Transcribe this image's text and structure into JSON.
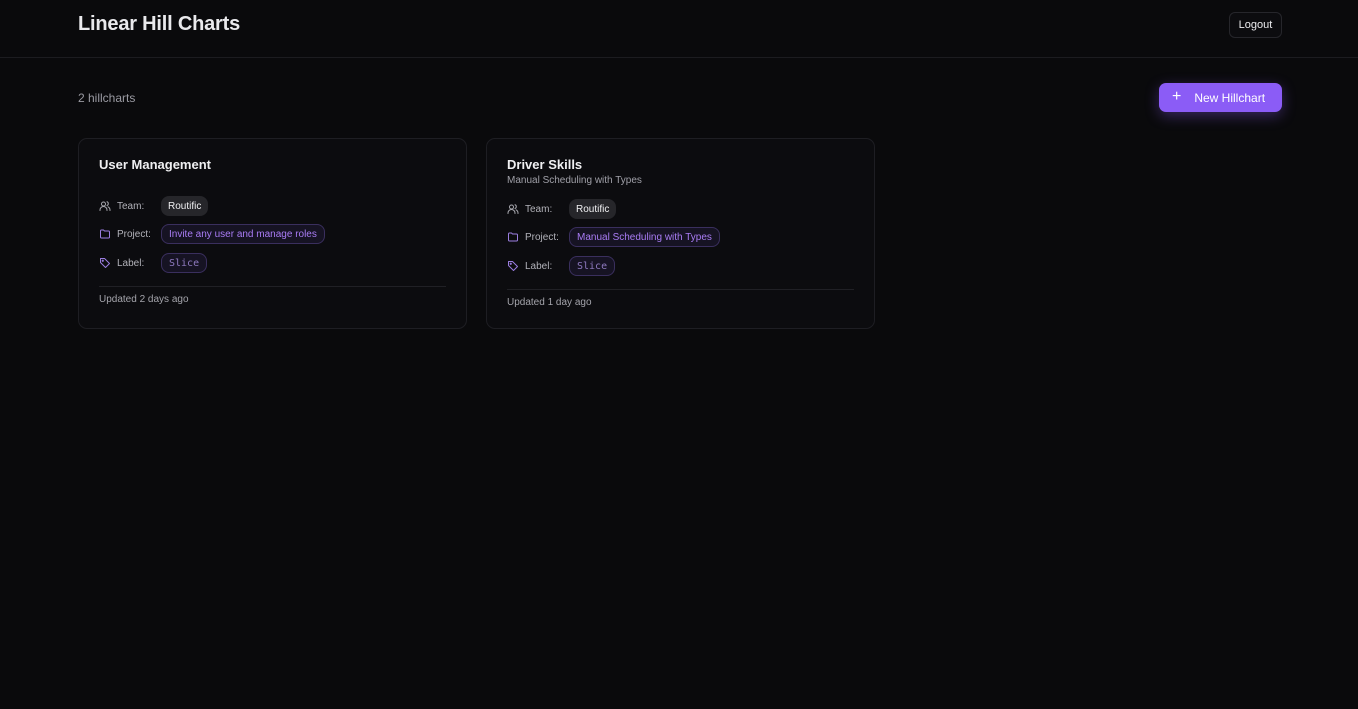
{
  "header": {
    "title": "Linear Hill Charts",
    "logout_label": "Logout"
  },
  "toolbar": {
    "count_text": "2 hillcharts",
    "new_button_label": "New Hillchart",
    "new_button_icon": "plus-icon"
  },
  "labels": {
    "team": "Team:",
    "project": "Project:",
    "label": "Label:"
  },
  "colors": {
    "accent": "#8b5cf6",
    "background": "#0a0a0c"
  },
  "cards": [
    {
      "title": "User Management",
      "subtitle": "",
      "team": "Routific",
      "project": "Invite any user and manage roles",
      "label": "Slice",
      "updated": "Updated 2 days ago"
    },
    {
      "title": "Driver Skills",
      "subtitle": "Manual Scheduling with Types",
      "team": "Routific",
      "project": "Manual Scheduling with Types",
      "label": "Slice",
      "updated": "Updated 1 day ago"
    }
  ]
}
